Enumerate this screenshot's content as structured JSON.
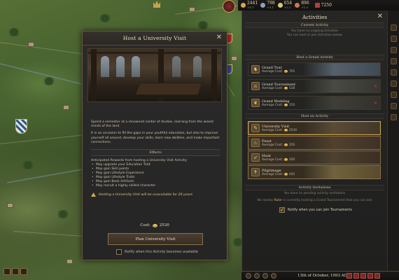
{
  "topbar": {
    "resources": [
      {
        "name": "gold",
        "icon": "gold-coin-icon",
        "value": "2441",
        "delta": "+5.7",
        "color": "#d4a84c"
      },
      {
        "name": "prestige",
        "icon": "prestige-icon",
        "value": "798",
        "delta": "+3.1",
        "color": "#8aa0c8"
      },
      {
        "name": "piety",
        "icon": "piety-icon",
        "value": "654",
        "delta": "+2.2",
        "color": "#d8c880"
      },
      {
        "name": "renown",
        "icon": "renown-icon",
        "value": "896",
        "delta": "+1.0",
        "color": "#c87a4a"
      }
    ],
    "levies": {
      "icon": "levies-icon",
      "value": "7250"
    }
  },
  "modal": {
    "title": "Host a University Visit",
    "description": [
      "Spend a semester at a renowned center of studies, learning from the wisest minds of the land.",
      "It is an occasion to fill the gaps in your youthful education, but also to improve yourself all around, develop your skills, learn new abilities, and make important connections."
    ],
    "effects_header": "Effects",
    "rewards_intro": "Anticipated Rewards from hosting a University Visit Activity:",
    "rewards": [
      "May upgrade your Education Trait",
      "May gain Skill points",
      "May gain Lifestyle Experience",
      "May gain Lifestyle Traits",
      "May gain Book Artifacts",
      "May recruit a highly skilled character"
    ],
    "warning": "Hosting a University Visit will be unavailable for 20 years",
    "cost_label": "Cost:",
    "cost_value": "2530",
    "plan_button": "Plan University Visit",
    "notify_label": "Notify when this Activity becomes available",
    "notify_checked": false
  },
  "sidebar": {
    "title": "Activities",
    "current_header": "Current Activity",
    "current_note_1": "You have no ongoing Activities",
    "current_note_2": "You can host or join Activities below.",
    "grand_header": "Host a Grand Activity",
    "grand_activities": [
      {
        "name": "Grand Tour",
        "cost": "Average Cost:",
        "value": "765",
        "icon": "horse-icon",
        "blocked": false
      },
      {
        "name": "Grand Tournament",
        "cost": "Average Cost:",
        "value": "528",
        "icon": "tournament-icon",
        "blocked": true
      },
      {
        "name": "Grand Wedding",
        "cost": "Average Cost:",
        "value": "150",
        "icon": "wedding-icon",
        "blocked": true
      }
    ],
    "host_header": "Host an Activity",
    "activities": [
      {
        "name": "University Visit",
        "cost": "Average Cost:",
        "value": "2530",
        "icon": "university-icon",
        "selected": true
      },
      {
        "name": "Feast",
        "cost": "Average Cost:",
        "value": "250",
        "icon": "feast-icon",
        "selected": false
      },
      {
        "name": "Hunt",
        "cost": "Average Cost:",
        "value": "200",
        "icon": "hunt-icon",
        "selected": false
      },
      {
        "name": "Pilgrimage",
        "cost": "Average Cost:",
        "value": "445",
        "icon": "pilgrimage-icon",
        "selected": false
      }
    ],
    "invitations_header": "Activity Invitations",
    "invitations_note_1": "You have no pending activity invitations",
    "invitations_note_2_prefix": "No nearby",
    "invitations_note_2_ruler": "Ruler",
    "invitations_note_2_suffix": "is currently hosting a Grand Tournament that you can join",
    "notify_tournaments_label": "Notify when you can join Tournaments",
    "notify_tournaments_checked": true
  },
  "bottombar": {
    "date": "13th of October, 1093 AD"
  },
  "colors": {
    "accent_gold": "#c9a24f",
    "panel_bg": "#262525",
    "text_main": "#e8dcc0",
    "warning_red": "#c83a3a"
  }
}
